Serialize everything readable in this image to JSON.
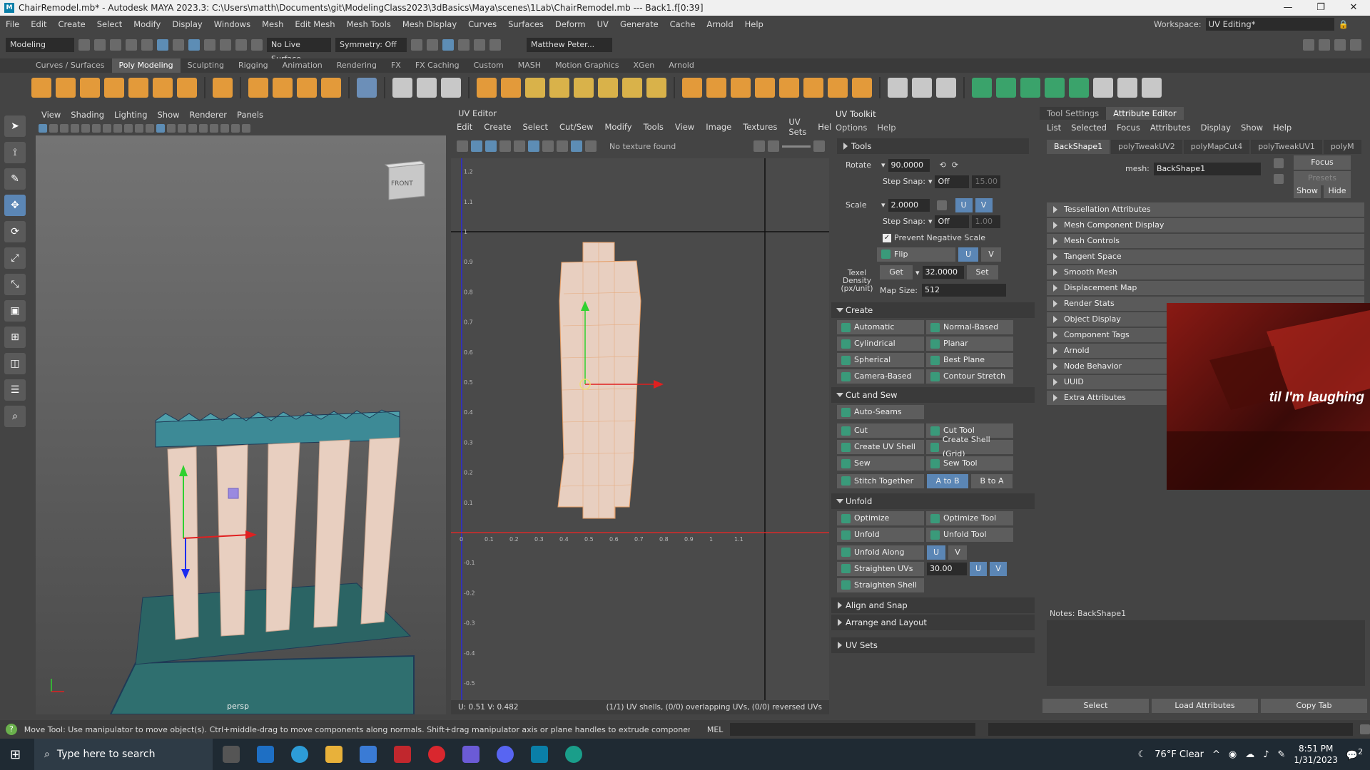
{
  "title": "ChairRemodel.mb* - Autodesk MAYA 2023.3: C:\\Users\\matth\\Documents\\git\\ModelingClass2023\\3dBasics\\Maya\\scenes\\1Lab\\ChairRemodel.mb  ---  Back1.f[0:39]",
  "menus": [
    "File",
    "Edit",
    "Create",
    "Select",
    "Modify",
    "Display",
    "Windows",
    "Mesh",
    "Edit Mesh",
    "Mesh Tools",
    "Mesh Display",
    "Curves",
    "Surfaces",
    "Deform",
    "UV",
    "Generate",
    "Cache",
    "Arnold",
    "Help"
  ],
  "workspace": {
    "label": "Workspace:",
    "value": "UV Editing*"
  },
  "status": {
    "mode": "Modeling",
    "live": "No Live Surface",
    "symmetry": "Symmetry: Off",
    "user": "Matthew Peter..."
  },
  "shelf_tabs": [
    "Curves / Surfaces",
    "Poly Modeling",
    "Sculpting",
    "Rigging",
    "Animation",
    "Rendering",
    "FX",
    "FX Caching",
    "Custom",
    "MASH",
    "Motion Graphics",
    "XGen",
    "Arnold"
  ],
  "viewport": {
    "menu": [
      "View",
      "Shading",
      "Lighting",
      "Show",
      "Renderer",
      "Panels"
    ],
    "cube": "FRONT",
    "camera": "persp"
  },
  "uv": {
    "title": "UV Editor",
    "menu": [
      "Edit",
      "Create",
      "Select",
      "Cut/Sew",
      "Modify",
      "Tools",
      "View",
      "Image",
      "Textures",
      "UV Sets",
      "Help"
    ],
    "no_texture": "No texture found",
    "coords": "U: 0.51  V: 0.482",
    "info": "(1/1) UV shells, (0/0) overlapping UVs, (0/0) reversed UVs",
    "xticks": [
      "0",
      "0.1",
      "0.2",
      "0.3",
      "0.4",
      "0.5",
      "0.6",
      "0.7",
      "0.8",
      "0.9",
      "1",
      "1.1"
    ],
    "yticks": [
      "1.2",
      "1.1",
      "1",
      "0.9",
      "0.8",
      "0.7",
      "0.6",
      "0.5",
      "0.4",
      "0.3",
      "0.2",
      "0.1",
      "-0.1",
      "-0.2",
      "-0.3",
      "-0.4",
      "-0.5"
    ]
  },
  "toolkit": {
    "title": "UV Toolkit",
    "menu": [
      "Options",
      "Help"
    ],
    "tools": "Tools",
    "rotate": {
      "label": "Rotate",
      "value": "90.0000"
    },
    "step_snap": "Step Snap:",
    "snap_off": "Off",
    "snap_val1": "15.00",
    "scale": {
      "label": "Scale",
      "value": "2.0000"
    },
    "snap_val2": "1.00",
    "prevent_neg": "Prevent Negative Scale",
    "flip": "Flip",
    "u": "U",
    "v": "V",
    "texel": "Texel Density (px/unit)",
    "get": "Get",
    "density": "32.0000",
    "set": "Set",
    "map_size_label": "Map Size:",
    "map_size": "512",
    "create": "Create",
    "create_btns": [
      "Automatic",
      "Normal-Based",
      "Cylindrical",
      "Planar",
      "Spherical",
      "Best Plane",
      "Camera-Based",
      "Contour Stretch"
    ],
    "cut_sew": "Cut and Sew",
    "auto_seams": "Auto-Seams",
    "cut_btns": [
      "Cut",
      "Cut Tool",
      "Create UV Shell",
      "Create Shell (Grid)",
      "Sew",
      "Sew Tool"
    ],
    "stitch": "Stitch Together",
    "atob": "A to B",
    "btoa": "B to A",
    "unfold": "Unfold",
    "unfold_btns": [
      "Optimize",
      "Optimize Tool",
      "Unfold",
      "Unfold Tool"
    ],
    "unfold_along": "Unfold Along",
    "straighten": "Straighten UVs",
    "straighten_val": "30.00",
    "straighten_shell": "Straighten Shell",
    "align": "Align and Snap",
    "arrange": "Arrange and Layout",
    "uvsets": "UV Sets"
  },
  "ae": {
    "tabs": [
      "Tool Settings",
      "Attribute Editor"
    ],
    "menu": [
      "List",
      "Selected",
      "Focus",
      "Attributes",
      "Display",
      "Show",
      "Help"
    ],
    "nodes": [
      "BackShape1",
      "polyTweakUV2",
      "polyMapCut4",
      "polyTweakUV1",
      "polyM"
    ],
    "mesh_label": "mesh:",
    "mesh": "BackShape1",
    "focus": "Focus",
    "presets": "Presets",
    "show": "Show",
    "hide": "Hide",
    "sections": [
      "Tessellation Attributes",
      "Mesh Component Display",
      "Mesh Controls",
      "Tangent Space",
      "Smooth Mesh",
      "Displacement Map",
      "Render Stats",
      "Object Display",
      "Component Tags",
      "Arnold",
      "Node Behavior",
      "UUID",
      "Extra Attributes"
    ],
    "notes": "Notes:  BackShape1",
    "bottom": [
      "Select",
      "Load Attributes",
      "Copy Tab"
    ]
  },
  "overlay_caption": "til I'm laughing",
  "helpline": {
    "text": "Move Tool: Use manipulator to move object(s). Ctrl+middle-drag to move components along normals. Shift+drag manipulator axis or plane handles to extrude components or clone objects. Ctrl+Shift+drag to c",
    "lang": "MEL"
  },
  "taskbar": {
    "search": "Type here to search",
    "weather": "76°F  Clear",
    "time": "8:51 PM",
    "date": "1/31/2023",
    "notif": "2"
  },
  "colors": {
    "accent": "#5b86b5",
    "teal": "#3a9a7a",
    "uvshell": "#e8cfc0"
  }
}
